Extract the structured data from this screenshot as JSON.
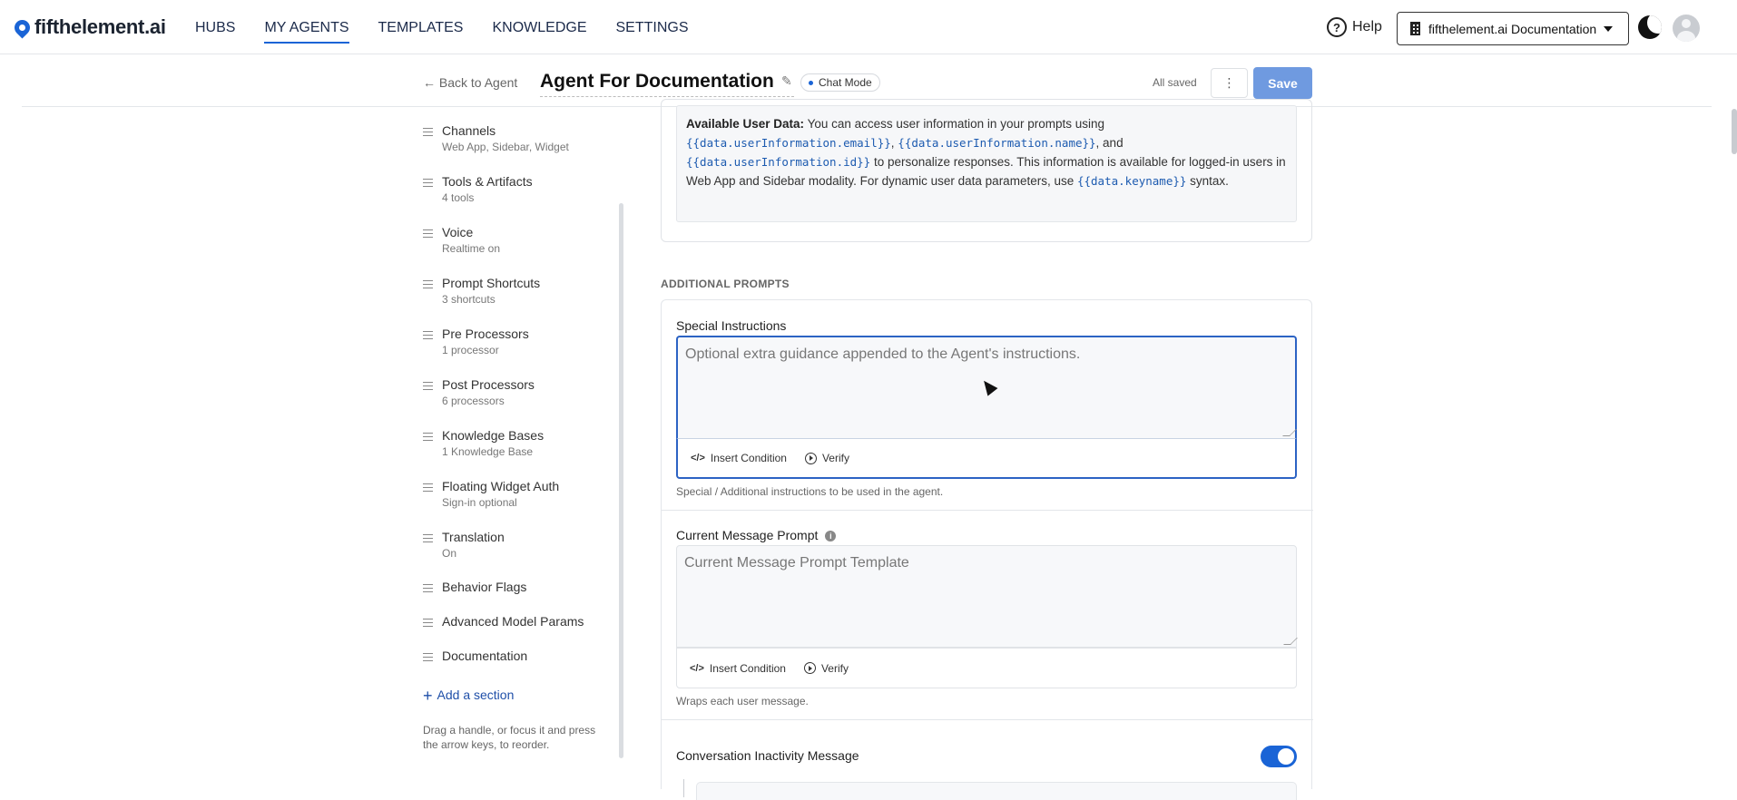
{
  "app": {
    "brand": "fifthelement.ai",
    "nav": [
      "HUBS",
      "MY AGENTS",
      "TEMPLATES",
      "KNOWLEDGE",
      "SETTINGS"
    ],
    "active_nav": "MY AGENTS",
    "help_label": "Help",
    "org_name": "fifthelement.ai Documentation",
    "accent_color": "#1a64d6"
  },
  "header": {
    "back_label": "Back to Agent",
    "agent_title": "Agent For Documentation",
    "mode_chip": "Chat Mode",
    "save_status": "All saved",
    "more_label": "⋮",
    "save_label": "Save"
  },
  "sidebar": {
    "items": [
      {
        "label": "Channels",
        "sub": "Web App, Sidebar, Widget"
      },
      {
        "label": "Tools & Artifacts",
        "sub": "4 tools"
      },
      {
        "label": "Voice",
        "sub": "Realtime on"
      },
      {
        "label": "Prompt Shortcuts",
        "sub": "3 shortcuts"
      },
      {
        "label": "Pre Processors",
        "sub": "1 processor"
      },
      {
        "label": "Post Processors",
        "sub": "6 processors"
      },
      {
        "label": "Knowledge Bases",
        "sub": "1 Knowledge Base"
      },
      {
        "label": "Floating Widget Auth",
        "sub": "Sign-in optional"
      },
      {
        "label": "Translation",
        "sub": "On"
      },
      {
        "label": "Behavior Flags",
        "sub": ""
      },
      {
        "label": "Advanced Model Params",
        "sub": ""
      },
      {
        "label": "Documentation",
        "sub": ""
      }
    ],
    "add_section_label": "Add a section",
    "drag_hint": "Drag a handle, or focus it and press the arrow keys, to reorder."
  },
  "info": {
    "heading": "Available User Data:",
    "text1": " You can access user information in your prompts using ",
    "code_email": "{{data.userInformation.email}}",
    "sep1": ", ",
    "code_name": "{{data.userInformation.name}}",
    "sep2": ", and ",
    "code_id": "{{data.userInformation.id}}",
    "text2": " to personalize responses. This information is available for logged-in users in Web App and Sidebar modality. For dynamic user data parameters, use ",
    "code_keyname": "{{data.keyname}}",
    "text3": " syntax."
  },
  "additional_prompts": {
    "section_title": "ADDITIONAL PROMPTS",
    "special": {
      "label": "Special Instructions",
      "placeholder": "Optional extra guidance appended to the Agent's instructions.",
      "hint": "Special / Additional instructions to be used in the agent."
    },
    "current_message": {
      "label": "Current Message Prompt",
      "placeholder": "Current Message Prompt Template",
      "hint": "Wraps each user message."
    },
    "toolbar": {
      "insert_condition": "Insert Condition",
      "verify": "Verify",
      "code_icon_glyph": "</>"
    },
    "inactivity": {
      "label": "Conversation Inactivity Message",
      "enabled": true
    }
  }
}
